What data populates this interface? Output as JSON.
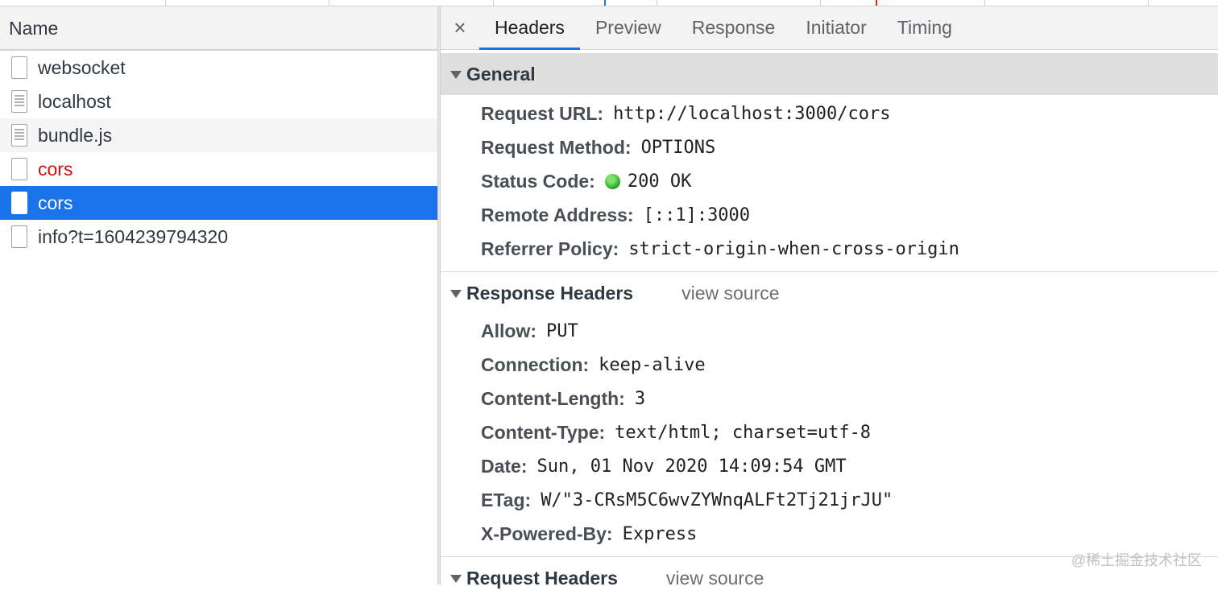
{
  "request_list": {
    "column_header": "Name",
    "items": [
      {
        "name": "websocket",
        "state": "normal"
      },
      {
        "name": "localhost",
        "state": "normal"
      },
      {
        "name": "bundle.js",
        "state": "normal"
      },
      {
        "name": "cors",
        "state": "error"
      },
      {
        "name": "cors",
        "state": "selected"
      },
      {
        "name": "info?t=1604239794320",
        "state": "normal"
      }
    ]
  },
  "detail_tabs": {
    "close": "×",
    "tabs": [
      "Headers",
      "Preview",
      "Response",
      "Initiator",
      "Timing"
    ],
    "active": "Headers"
  },
  "general": {
    "title": "General",
    "rows": [
      {
        "key": "Request URL:",
        "value": "http://localhost:3000/cors"
      },
      {
        "key": "Request Method:",
        "value": "OPTIONS"
      },
      {
        "key": "Status Code:",
        "value": "200 OK"
      },
      {
        "key": "Remote Address:",
        "value": "[::1]:3000"
      },
      {
        "key": "Referrer Policy:",
        "value": "strict-origin-when-cross-origin"
      }
    ]
  },
  "response_headers": {
    "title": "Response Headers",
    "view_source": "view source",
    "rows": [
      {
        "key": "Allow:",
        "value": "PUT"
      },
      {
        "key": "Connection:",
        "value": "keep-alive"
      },
      {
        "key": "Content-Length:",
        "value": "3"
      },
      {
        "key": "Content-Type:",
        "value": "text/html; charset=utf-8"
      },
      {
        "key": "Date:",
        "value": "Sun, 01 Nov 2020 14:09:54 GMT"
      },
      {
        "key": "ETag:",
        "value": "W/\"3-CRsM5C6wvZYWnqALFt2Tj21jrJU\""
      },
      {
        "key": "X-Powered-By:",
        "value": "Express"
      }
    ]
  },
  "request_headers": {
    "title": "Request Headers",
    "view_source": "view source"
  },
  "watermark": "@稀土掘金技术社区",
  "colors": {
    "accent": "#1a73e8",
    "error_text": "#d50f0f",
    "status_ok": "#1fa61f"
  }
}
